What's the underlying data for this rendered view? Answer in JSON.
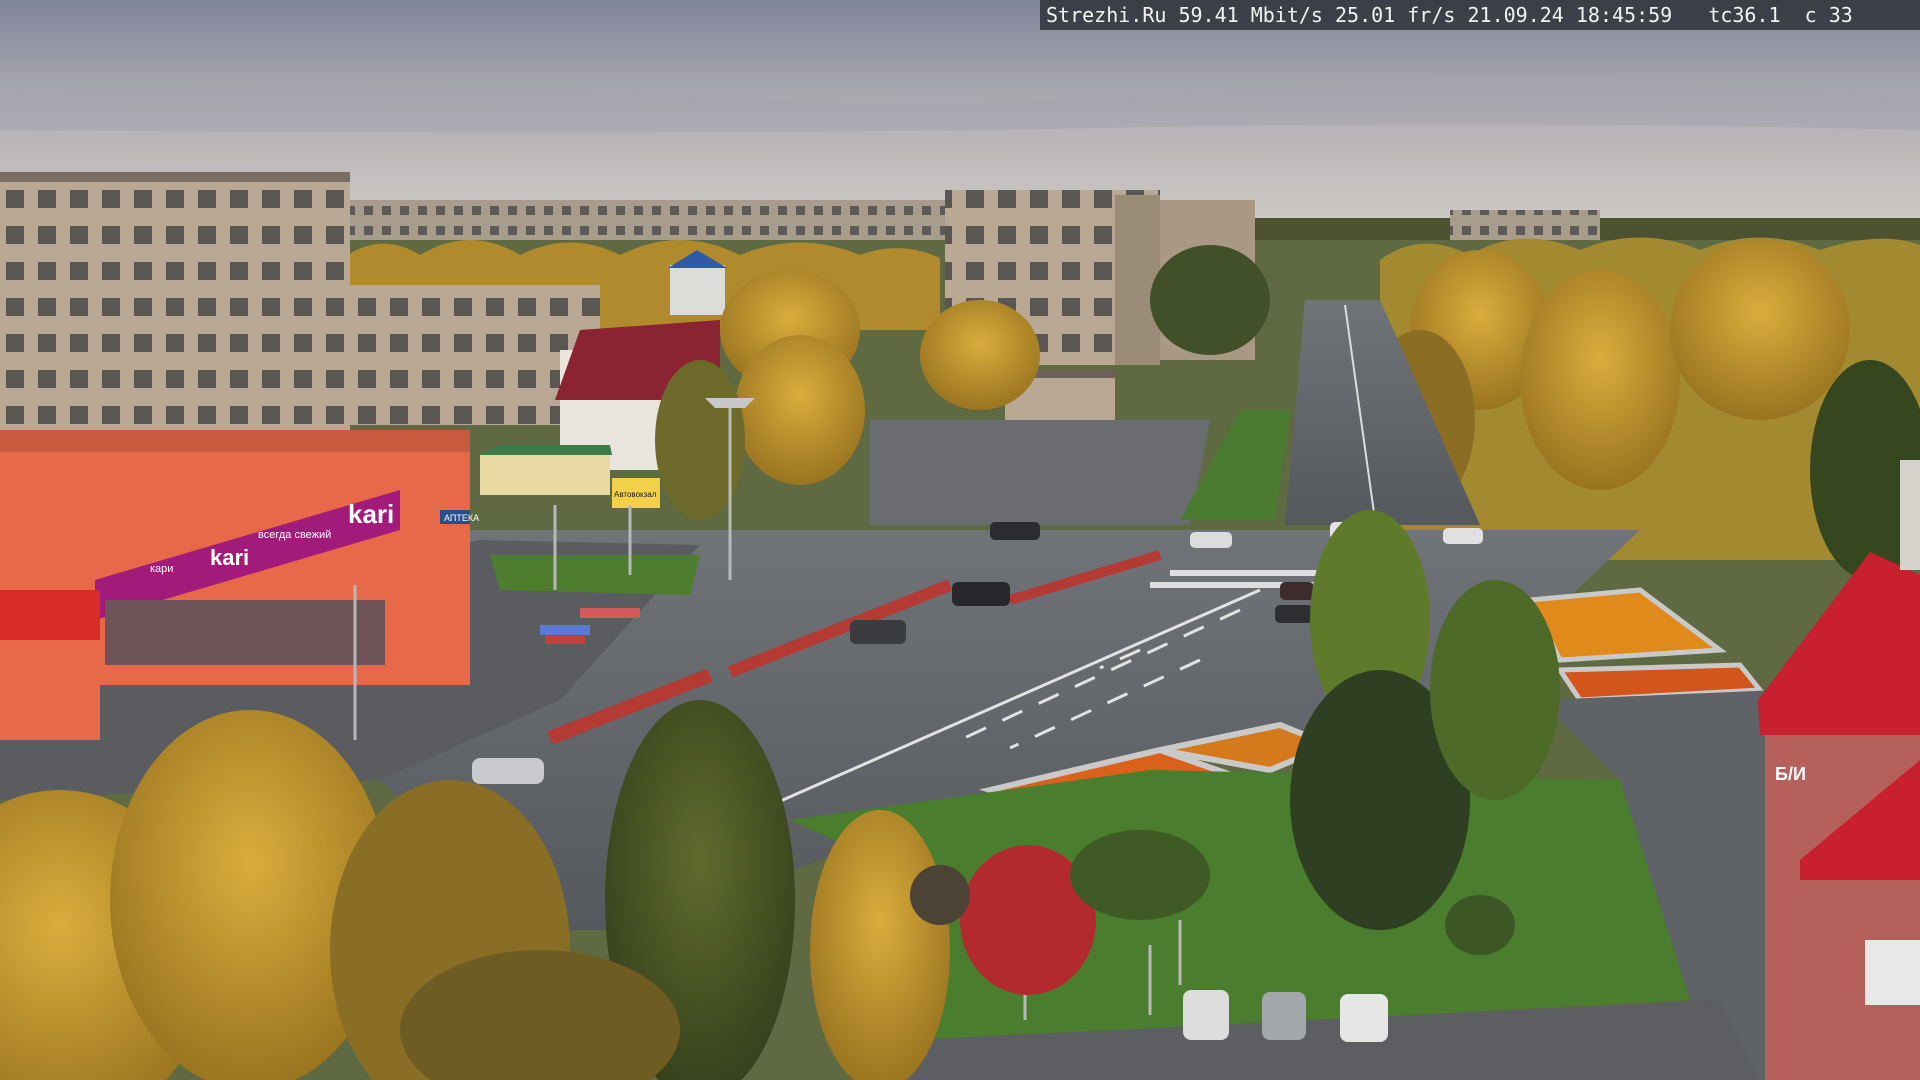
{
  "overlay": {
    "site": "Strezhi.Ru",
    "bitrate": "59.41 Mbit/s",
    "framerate": "25.01 fr/s",
    "date": "21.09.24",
    "time": "18:45:59",
    "camera": "tc36.1",
    "counter": "c 33"
  },
  "signs": {
    "store_brand": "kari",
    "store_slogan_left": "kari",
    "store_slogan_small_1": "всегда свежий",
    "store_slogan_small_2": "кари",
    "store_entrance_label": "АПТЕКА",
    "kiosk_label": "Автовокзал",
    "right_building_brand": "Б/И"
  },
  "colors": {
    "sky_top": "#8b8fa0",
    "sky_bottom": "#c9c6c4",
    "kari_magenta": "#a21a7a",
    "store_orange": "#e86b4b",
    "red_roof": "#c8202e",
    "asphalt": "#5d6064",
    "grass": "#3f7a2f",
    "autumn_yellow": "#c89a2a"
  }
}
